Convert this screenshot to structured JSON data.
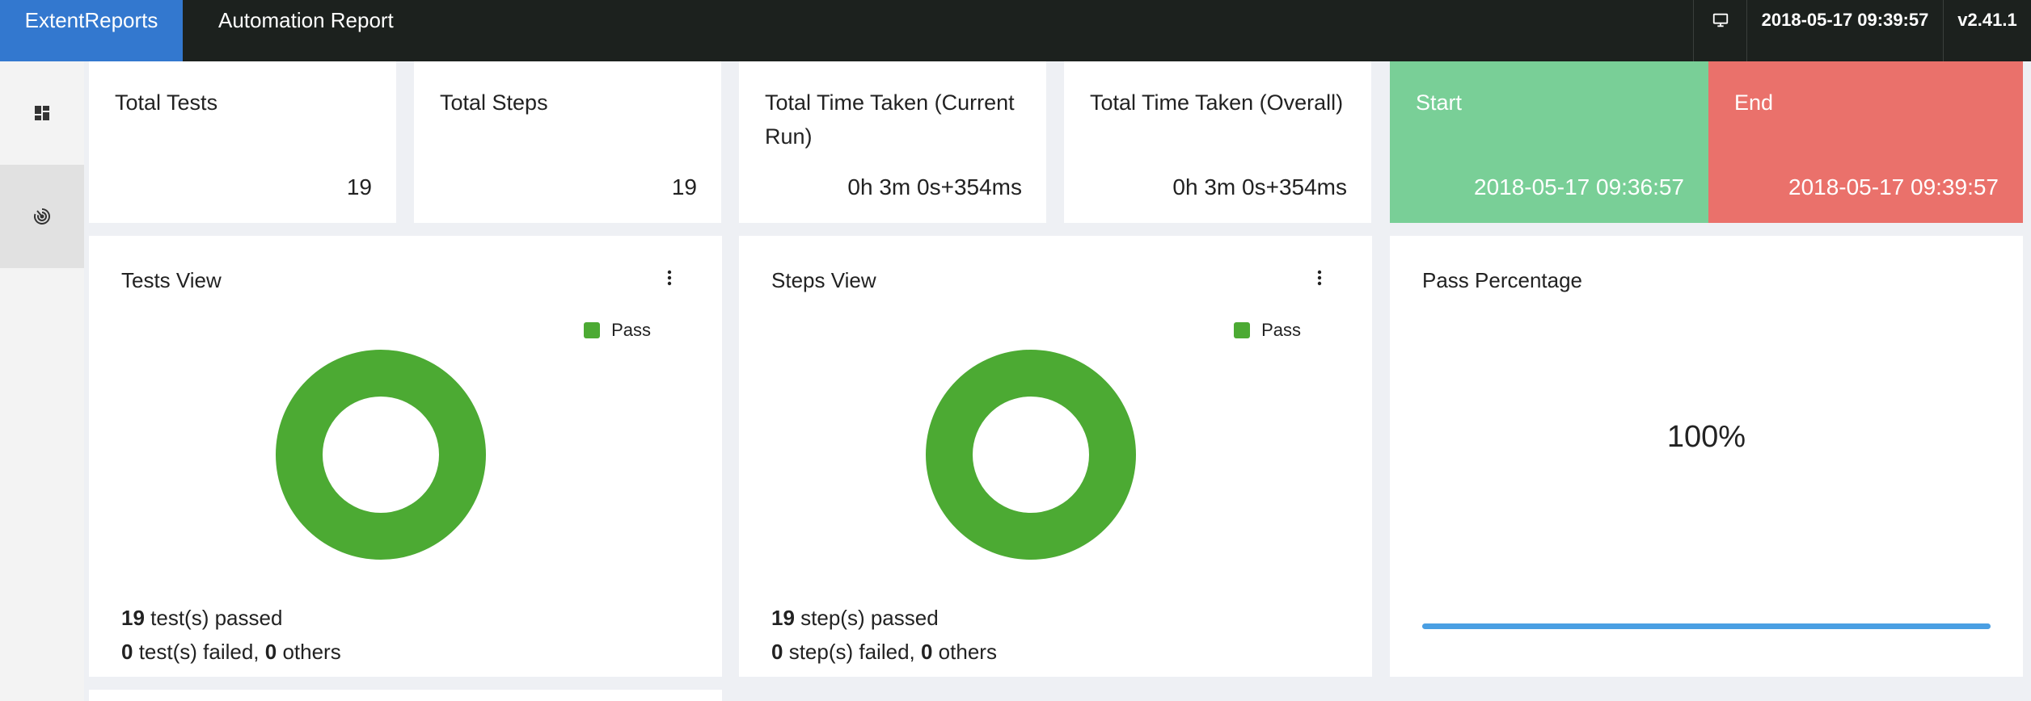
{
  "nav": {
    "brand": "ExtentReports",
    "report_name": "Automation Report",
    "date": "2018-05-17 09:39:57",
    "version": "v2.41.1"
  },
  "sidebar": {
    "items": [
      {
        "icon": "dashboard-icon",
        "active": false
      },
      {
        "icon": "radar-icon",
        "active": true
      }
    ]
  },
  "stats": {
    "total_tests": {
      "label": "Total Tests",
      "value": "19"
    },
    "total_steps": {
      "label": "Total Steps",
      "value": "19"
    },
    "time_current": {
      "label": "Total Time Taken (Current Run)",
      "value": "0h 3m 0s+354ms"
    },
    "time_overall": {
      "label": "Total Time Taken (Overall)",
      "value": "0h 3m 0s+354ms"
    },
    "start": {
      "label": "Start",
      "value": "2018-05-17 09:36:57"
    },
    "end": {
      "label": "End",
      "value": "2018-05-17 09:39:57"
    }
  },
  "tests_view": {
    "title": "Tests View",
    "legend": "Pass",
    "passed_count": "19",
    "passed_text": " test(s) passed",
    "failed_count": "0",
    "failed_text": " test(s) failed, ",
    "others_count": "0",
    "others_text": " others"
  },
  "steps_view": {
    "title": "Steps View",
    "legend": "Pass",
    "passed_count": "19",
    "passed_text": " step(s) passed",
    "failed_count": "0",
    "failed_text": " step(s) failed, ",
    "others_count": "0",
    "others_text": " others"
  },
  "pass_percentage": {
    "title": "Pass Percentage",
    "value": "100%",
    "fraction": 1.0
  },
  "colors": {
    "brand": "#3378cf",
    "pass": "#4caa33",
    "start": "#79cf97",
    "end": "#ea716b",
    "progress": "#4a9fe3"
  }
}
